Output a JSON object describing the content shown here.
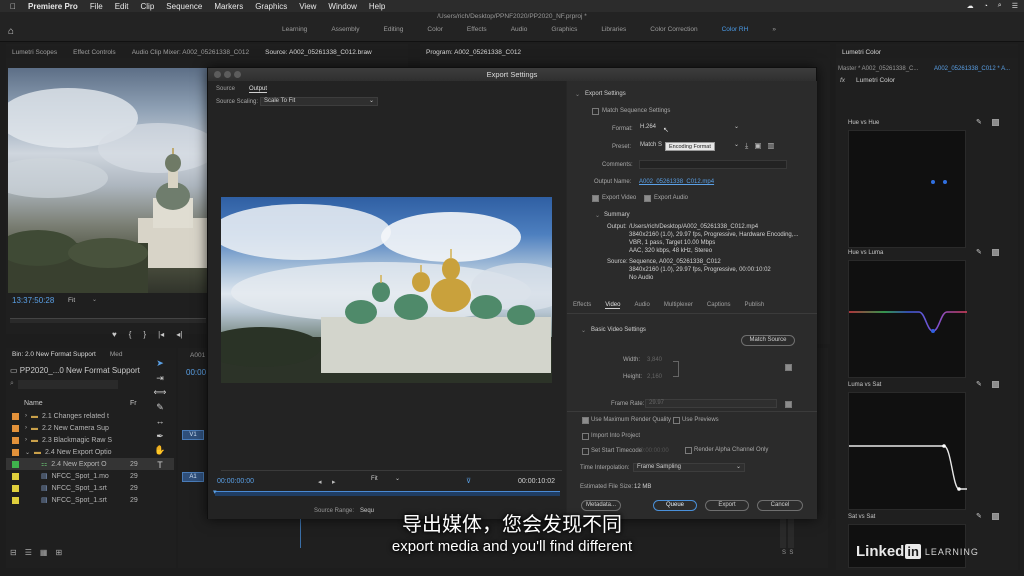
{
  "menubar": {
    "app": "Premiere Pro",
    "items": [
      "File",
      "Edit",
      "Clip",
      "Sequence",
      "Markers",
      "Graphics",
      "View",
      "Window",
      "Help"
    ]
  },
  "window": {
    "title": "/Users/rich/Desktop/PPNF2020/PP2020_NF.prproj *"
  },
  "workspaces": {
    "tabs": [
      "Learning",
      "Assembly",
      "Editing",
      "Color",
      "Effects",
      "Audio",
      "Graphics",
      "Libraries",
      "Color Correction",
      "Color RH"
    ],
    "active": "Color RH"
  },
  "left_panel": {
    "tabs": [
      "Lumetri Scopes",
      "Effect Controls",
      "Audio Clip Mixer: A002_05261338_C012",
      "Source: A002_05261338_C012.braw"
    ],
    "timecode": "13:37:50:28",
    "fit": "Fit"
  },
  "program": {
    "title": "Program: A002_05261338_C012"
  },
  "project": {
    "tabs": [
      "Bin: 2.0 New Format Support",
      "Med"
    ],
    "path": "PP2020_...0 New Format Support",
    "name_header": "Name",
    "fr_header": "Fr",
    "rows": [
      {
        "name": "2.1 Changes related t",
        "color": "#e2913a",
        "fr": ""
      },
      {
        "name": "2.2 New Camera Sup",
        "color": "#e2913a",
        "fr": ""
      },
      {
        "name": "2.3 Blackmagic Raw S",
        "color": "#e2913a",
        "fr": ""
      },
      {
        "name": "2.4 New Export Optio",
        "color": "#e2913a",
        "fr": ""
      },
      {
        "name": "2.4 New Export O",
        "color": "#3fb44d",
        "fr": "29"
      },
      {
        "name": "NFCC_Spot_1.mo",
        "color": "#e0cf3c",
        "fr": "29"
      },
      {
        "name": "NFCC_Spot_1.srt",
        "color": "#e0cf3c",
        "fr": "29"
      },
      {
        "name": "NFCC_Spot_1.srt",
        "color": "#e0cf3c",
        "fr": "29"
      }
    ]
  },
  "timeline": {
    "label": "A001",
    "timecode": "00:00"
  },
  "lumetri": {
    "title": "Lumetri Color",
    "master": "Master * A002_05261338_C...",
    "clip": "A002_05261338_C012 * A...",
    "fx": "fx",
    "effect": "Lumetri Color",
    "curves": [
      "Hue vs Hue",
      "Hue vs Luma",
      "Luma vs Sat",
      "Sat vs Sat"
    ]
  },
  "dialog": {
    "title": "Export Settings",
    "left_tabs": [
      "Source",
      "Output"
    ],
    "source_scaling_label": "Source Scaling:",
    "source_scaling_value": "Scale To Fit",
    "timecode_in": "00:00:00:00",
    "timecode_out": "00:00:10:02",
    "fit": "Fit",
    "source_range_label": "Source Range:",
    "source_range_value": "Sequ",
    "export_settings": {
      "section": "Export Settings",
      "match_sequence": "Match Sequence Settings",
      "format_label": "Format:",
      "format_value": "H.264",
      "tooltip": "Encoding Format",
      "preset_label": "Preset:",
      "preset_value": "Match S",
      "comments_label": "Comments:",
      "output_name_label": "Output Name:",
      "output_name_value": "A002_05261338_C012.mp4",
      "export_video": "Export Video",
      "export_audio": "Export Audio"
    },
    "summary": {
      "title": "Summary",
      "output_label": "Output:",
      "output_lines": [
        "/Users/rich/Desktop/A002_05261338_C012.mp4",
        "3840x2160 (1.0), 29.97 fps, Progressive, Hardware Encoding,...",
        "VBR, 1 pass, Target 10.00 Mbps",
        "AAC, 320 kbps, 48 kHz, Stereo"
      ],
      "source_label": "Source:",
      "source_lines": [
        "Sequence, A002_05261338_C012",
        "3840x2160 (1.0), 29.97 fps, Progressive, 00:00:10:02",
        "No Audio"
      ]
    },
    "tabs": [
      "Effects",
      "Video",
      "Audio",
      "Multiplexer",
      "Captions",
      "Publish"
    ],
    "active_tab": "Video",
    "video": {
      "section": "Basic Video Settings",
      "match_source": "Match Source",
      "width_label": "Width:",
      "width_value": "3,840",
      "height_label": "Height:",
      "height_value": "2,160",
      "frame_rate_label": "Frame Rate:",
      "frame_rate_value": "29.97"
    },
    "options": {
      "max_render": "Use Maximum Render Quality",
      "use_previews": "Use Previews",
      "import_project": "Import Into Project",
      "set_start_tc": "Set Start Timecode",
      "start_tc_value": "00:00:00:00",
      "render_alpha": "Render Alpha Channel Only",
      "time_interp_label": "Time Interpolation:",
      "time_interp_value": "Frame Sampling",
      "file_size_label": "Estimated File Size:",
      "file_size_value": "12 MB"
    },
    "buttons": {
      "metadata": "Metadata...",
      "queue": "Queue",
      "export": "Export",
      "cancel": "Cancel"
    }
  },
  "subtitles": {
    "chinese": "导出媒体，您会发现不同",
    "english": "export media and you'll find different"
  },
  "watermark": {
    "linked": "Linked",
    "in": "in",
    "learning": "LEARNING"
  }
}
